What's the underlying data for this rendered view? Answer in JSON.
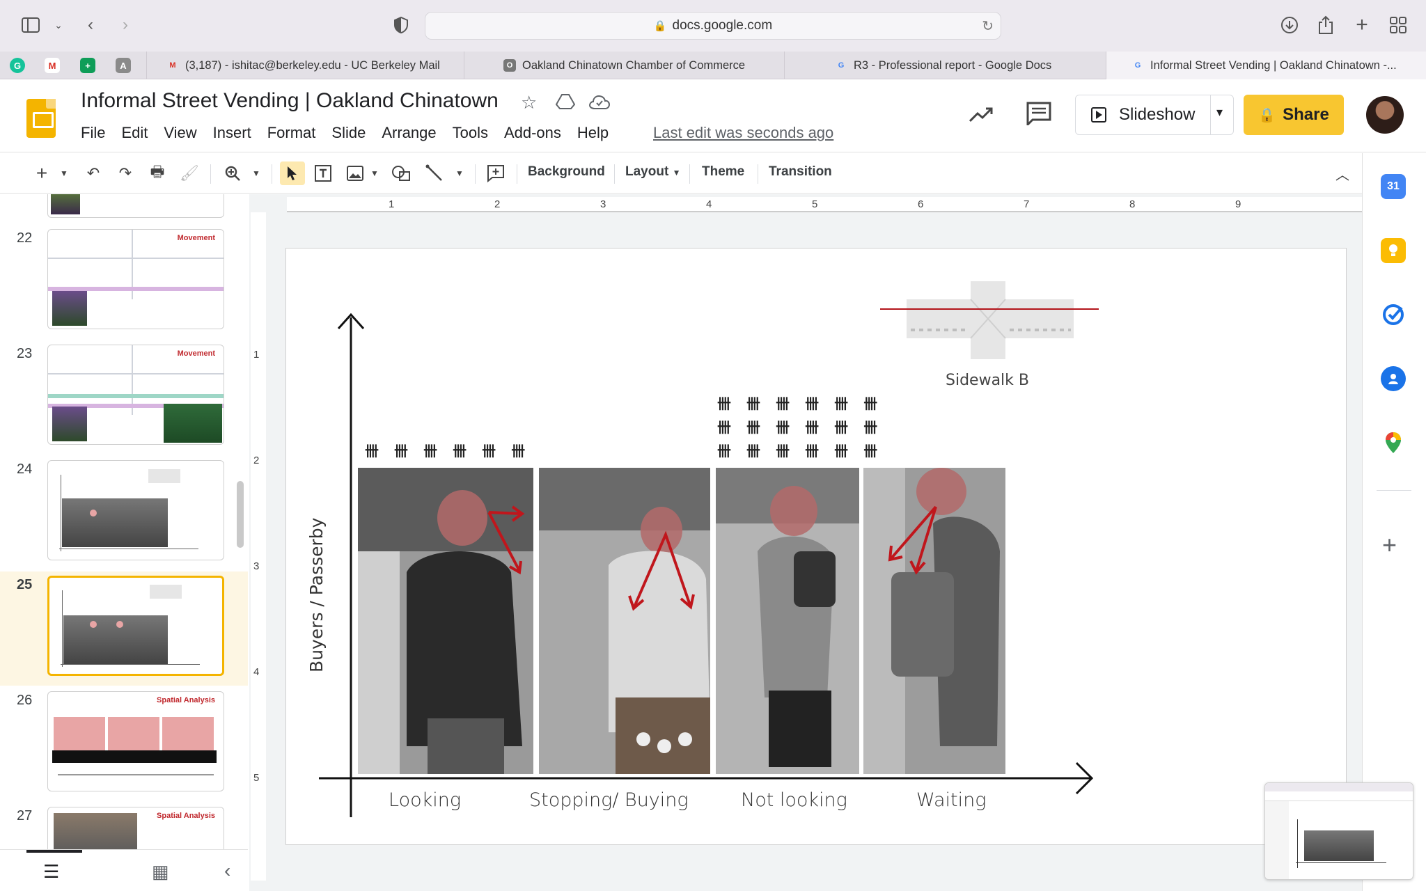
{
  "browser": {
    "url": "docs.google.com",
    "tabs": [
      {
        "label": "(3,187) - ishitac@berkeley.edu - UC Berkeley Mail",
        "favicon": "M",
        "color": "#d93025"
      },
      {
        "label": "Oakland Chinatown Chamber of Commerce",
        "favicon": "O",
        "color": "#777777"
      },
      {
        "label": "R3 - Professional report - Google Docs",
        "favicon": "G",
        "color": "#4285f4"
      },
      {
        "label": "Informal Street Vending | Oakland Chinatown -...",
        "favicon": "G",
        "color": "#4285f4"
      }
    ],
    "bookmark_favicons": [
      "G",
      "M",
      "+",
      "A"
    ]
  },
  "doc": {
    "title": "Informal Street Vending | Oakland Chinatown",
    "menu": [
      "File",
      "Edit",
      "View",
      "Insert",
      "Format",
      "Slide",
      "Arrange",
      "Tools",
      "Add-ons",
      "Help"
    ],
    "last_edit": "Last edit was seconds ago",
    "slideshow_label": "Slideshow",
    "share_label": "Share"
  },
  "toolbar": {
    "background_label": "Background",
    "layout_label": "Layout",
    "theme_label": "Theme",
    "transition_label": "Transition"
  },
  "ruler": {
    "horizontal": [
      "1",
      "2",
      "3",
      "4",
      "5",
      "6",
      "7",
      "8",
      "9"
    ],
    "vertical": [
      "1",
      "2",
      "3",
      "4",
      "5"
    ]
  },
  "filmstrip": {
    "slides": [
      {
        "number": "22",
        "title": "Movement"
      },
      {
        "number": "23",
        "title": "Movement"
      },
      {
        "number": "24",
        "title": ""
      },
      {
        "number": "25",
        "title": ""
      },
      {
        "number": "26",
        "title": "Spatial Analysis"
      },
      {
        "number": "27",
        "title": "Spatial Analysis"
      }
    ],
    "selected": "25"
  },
  "slide": {
    "y_axis_label": "Buyers / Passerby",
    "categories": [
      "Looking",
      "Stopping/ Buying",
      "Not looking",
      "Waiting"
    ],
    "tally_marks": [
      "卌 卌 卌 卌 卌 卌",
      "卌 卌 卌 卌 卌 卌",
      "卌 卌 卌 卌 卌 卌",
      "卌 卌 卌 卌 卌 卌"
    ],
    "map_label": "Sidewalk B"
  },
  "colors": {
    "accent_yellow": "#f4b400",
    "share_yellow": "#f8c630",
    "annotation_red": "#c0161c"
  }
}
